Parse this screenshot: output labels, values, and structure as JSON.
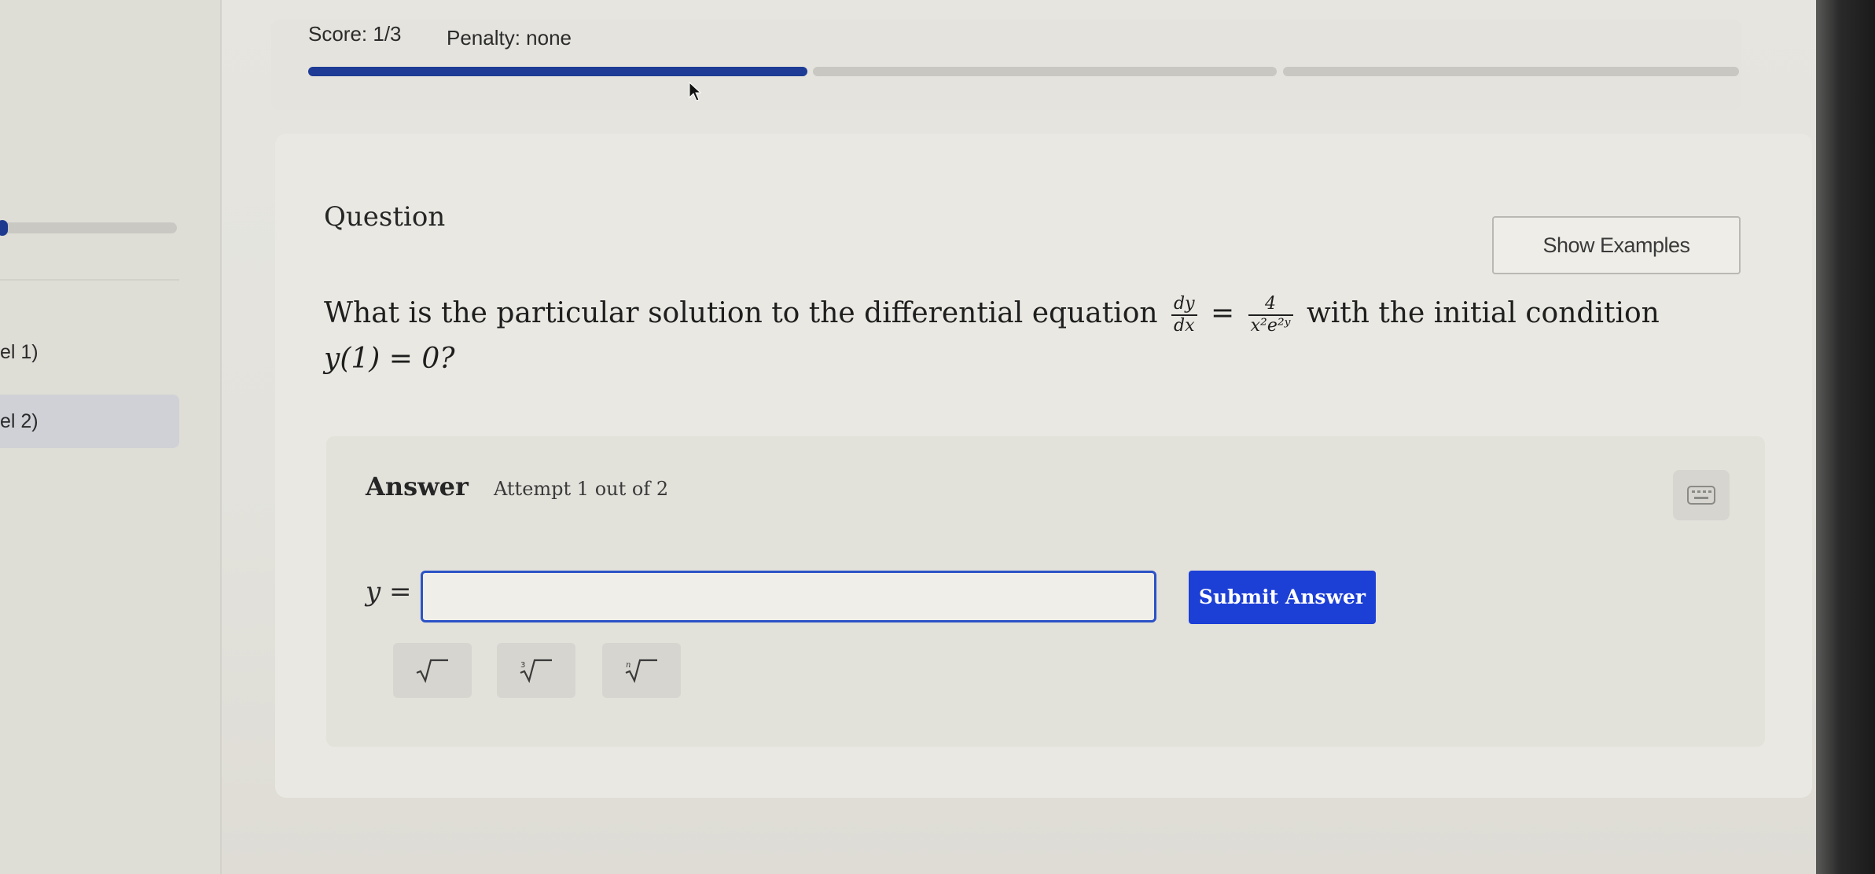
{
  "header": {
    "score": "Score: 1/3",
    "penalty": "Penalty: none",
    "progress_segments": [
      {
        "status": "complete",
        "fill": 1.0
      },
      {
        "status": "incomplete",
        "fill": 0
      },
      {
        "status": "incomplete",
        "fill": 0
      }
    ]
  },
  "sidebar": {
    "items": [
      {
        "label": "el 1)"
      },
      {
        "label": "el 2)"
      }
    ]
  },
  "question": {
    "heading": "Question",
    "show_examples_label": "Show Examples",
    "text_before": "What is the particular solution to the differential equation",
    "lhs_numerator": "dy",
    "lhs_denominator": "dx",
    "equals": "=",
    "rhs_numerator": "4",
    "rhs_denominator": "x²e²ʸ",
    "text_after": "with the initial condition",
    "condition": "y(1) = 0?"
  },
  "answer": {
    "heading": "Answer",
    "attempt": "Attempt 1 out of 2",
    "input_label": "y =",
    "input_value": "",
    "submit_label": "Submit Answer",
    "math_buttons": [
      {
        "icon": "square-root-icon"
      },
      {
        "icon": "cube-root-icon"
      },
      {
        "icon": "nth-root-icon"
      }
    ]
  },
  "colors": {
    "accent": "#1c3fd6",
    "progress_fill": "#1e3c95",
    "input_border": "#2b52c6"
  }
}
